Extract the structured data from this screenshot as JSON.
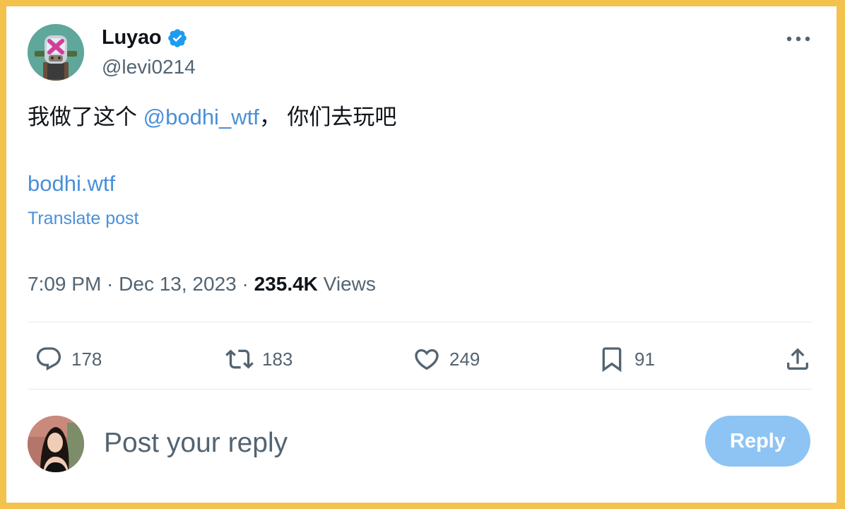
{
  "author": {
    "name": "Luyao",
    "handle": "@levi0214",
    "verified_icon": "verified-badge-icon"
  },
  "tweet": {
    "text_before": "我做了这个 ",
    "mention": "@bodhi_wtf",
    "text_after": "， 你们去玩吧",
    "link": "bodhi.wtf",
    "translate": "Translate post"
  },
  "meta": {
    "time": "7:09 PM · Dec 13, 2023 · ",
    "views_count": "235.4K",
    "views_label": " Views"
  },
  "actions": {
    "replies": "178",
    "reposts": "183",
    "likes": "249",
    "bookmarks": "91"
  },
  "reply_box": {
    "placeholder": "Post your reply",
    "button": "Reply"
  },
  "colors": {
    "frame": "#f3c24d",
    "accent": "#4a90d9",
    "reply_button": "#8ec4f3",
    "muted": "#536471"
  }
}
